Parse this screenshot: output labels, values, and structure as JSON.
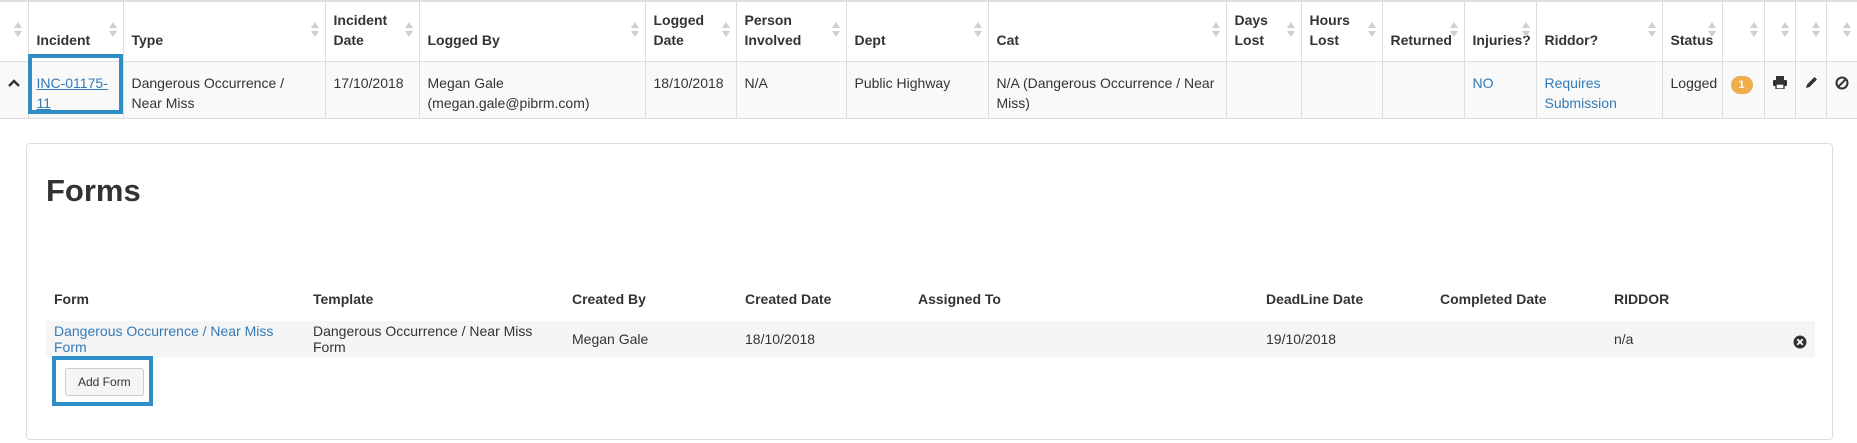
{
  "table": {
    "headers": [
      "Incident",
      "Type",
      "Incident Date",
      "Logged By",
      "Logged Date",
      "Person Involved",
      "Dept",
      "Cat",
      "Days Lost",
      "Hours Lost",
      "Returned",
      "Injuries?",
      "Riddor?",
      "Status"
    ],
    "row": {
      "incident": "INC-01175-11",
      "type": "Dangerous Occurrence / Near Miss",
      "incident_date": "17/10/2018",
      "logged_by_name": "Megan Gale",
      "logged_by_email": "(megan.gale@pibrm.com)",
      "logged_date": "18/10/2018",
      "person_involved": "N/A",
      "dept": "Public Highway",
      "cat": "N/A (Dangerous Occurrence / Near Miss)",
      "days_lost": "",
      "hours_lost": "",
      "returned": "",
      "injuries": "NO",
      "riddor": "Requires Submission",
      "status": "Logged",
      "badge_count": "1"
    }
  },
  "forms": {
    "title": "Forms",
    "headers": [
      "Form",
      "Template",
      "Created By",
      "Created Date",
      "Assigned To",
      "DeadLine Date",
      "Completed Date",
      "RIDDOR"
    ],
    "row": {
      "form": "Dangerous Occurrence / Near Miss Form",
      "template": "Dangerous Occurrence / Near Miss Form",
      "created_by": "Megan Gale",
      "created_date": "18/10/2018",
      "assigned_to": "",
      "deadline_date": "19/10/2018",
      "completed_date": "",
      "riddor": "n/a"
    },
    "add_button": "Add Form"
  },
  "colors": {
    "link": "#337ab7",
    "badge": "#f0ad4e",
    "highlight": "#2e8fc7"
  }
}
